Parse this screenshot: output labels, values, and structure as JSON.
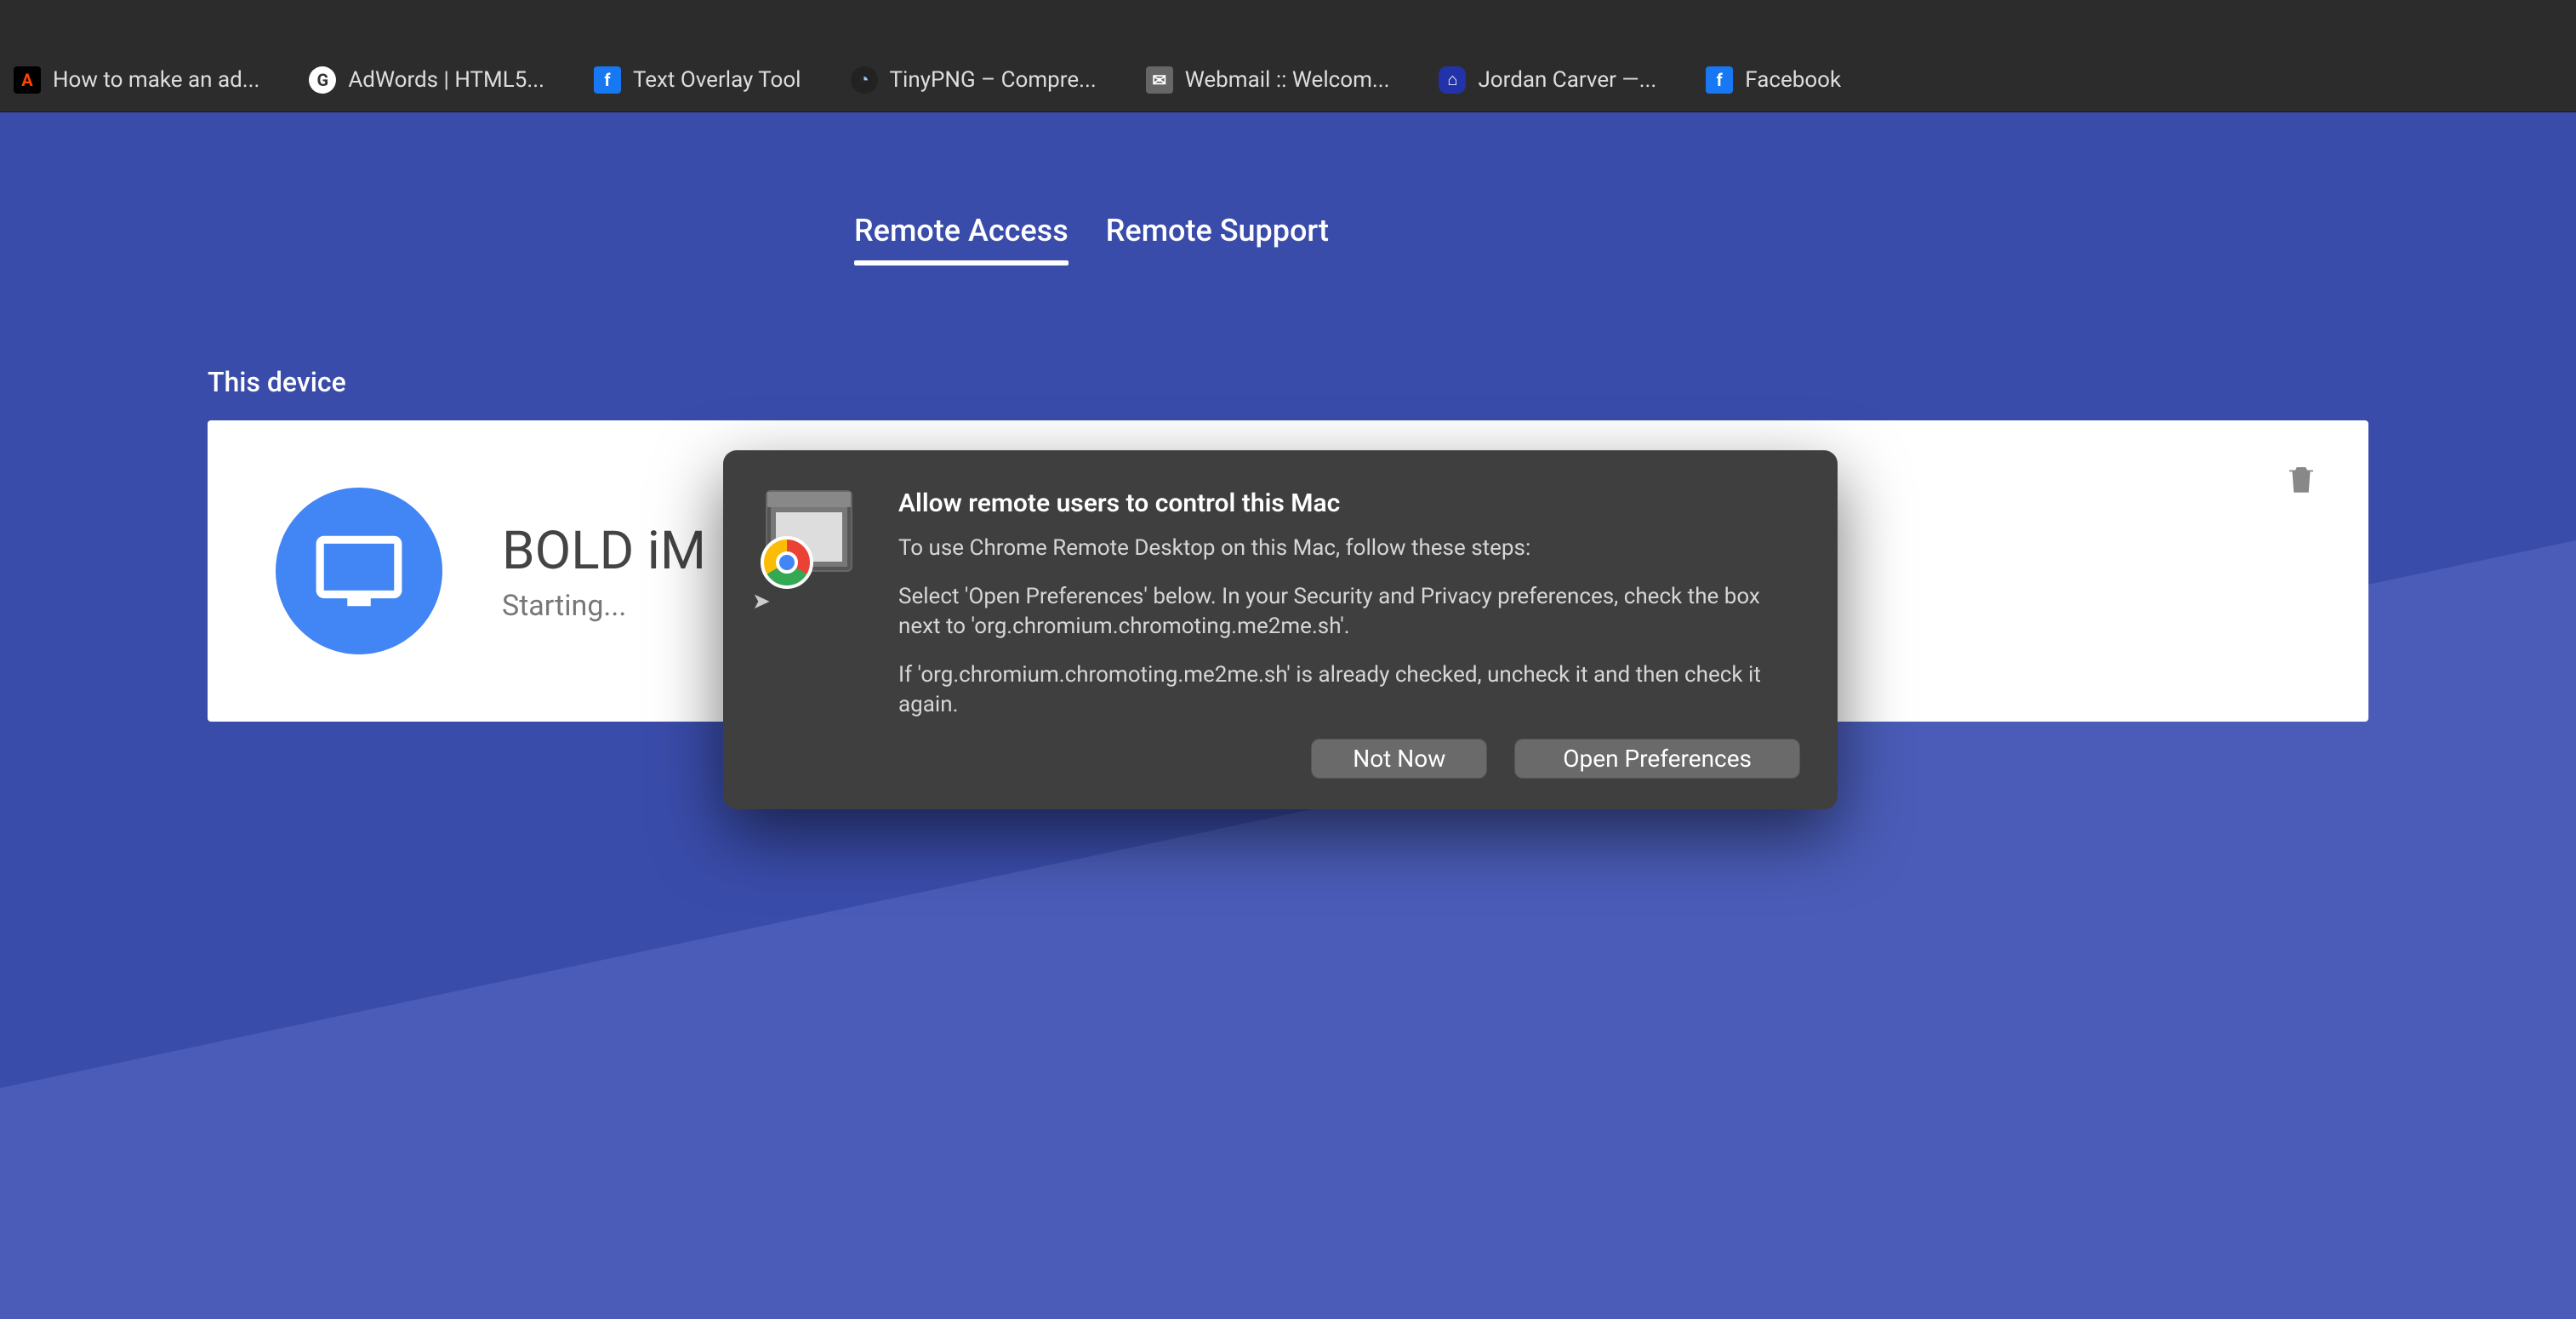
{
  "bookmarks": [
    {
      "label": "How to make an ad...",
      "iconClass": "bm-ad",
      "iconGlyph": "A"
    },
    {
      "label": "AdWords | HTML5...",
      "iconClass": "bm-g",
      "iconGlyph": "G"
    },
    {
      "label": "Text Overlay Tool",
      "iconClass": "bm-fb",
      "iconGlyph": "f"
    },
    {
      "label": "TinyPNG – Compre...",
      "iconClass": "bm-tiny",
      "iconGlyph": "◔"
    },
    {
      "label": "Webmail :: Welcom...",
      "iconClass": "bm-mail",
      "iconGlyph": "✉"
    },
    {
      "label": "Jordan Carver —...",
      "iconClass": "bm-jc",
      "iconGlyph": "⌂"
    },
    {
      "label": "Facebook",
      "iconClass": "bm-fb",
      "iconGlyph": "f"
    }
  ],
  "tabs": {
    "remote_access": "Remote Access",
    "remote_support": "Remote Support"
  },
  "section_title": "This device",
  "device": {
    "name": "BOLD iM",
    "status": "Starting..."
  },
  "dialog": {
    "title": "Allow remote users to control this Mac",
    "p1": "To use Chrome Remote Desktop on this Mac, follow these steps:",
    "p2": "Select 'Open Preferences' below. In your Security and Privacy preferences, check the box next to 'org.chromium.chromoting.me2me.sh'.",
    "p3": "If 'org.chromium.chromoting.me2me.sh' is already checked, uncheck it and then check it again.",
    "not_now": "Not Now",
    "open_prefs": "Open Preferences"
  }
}
